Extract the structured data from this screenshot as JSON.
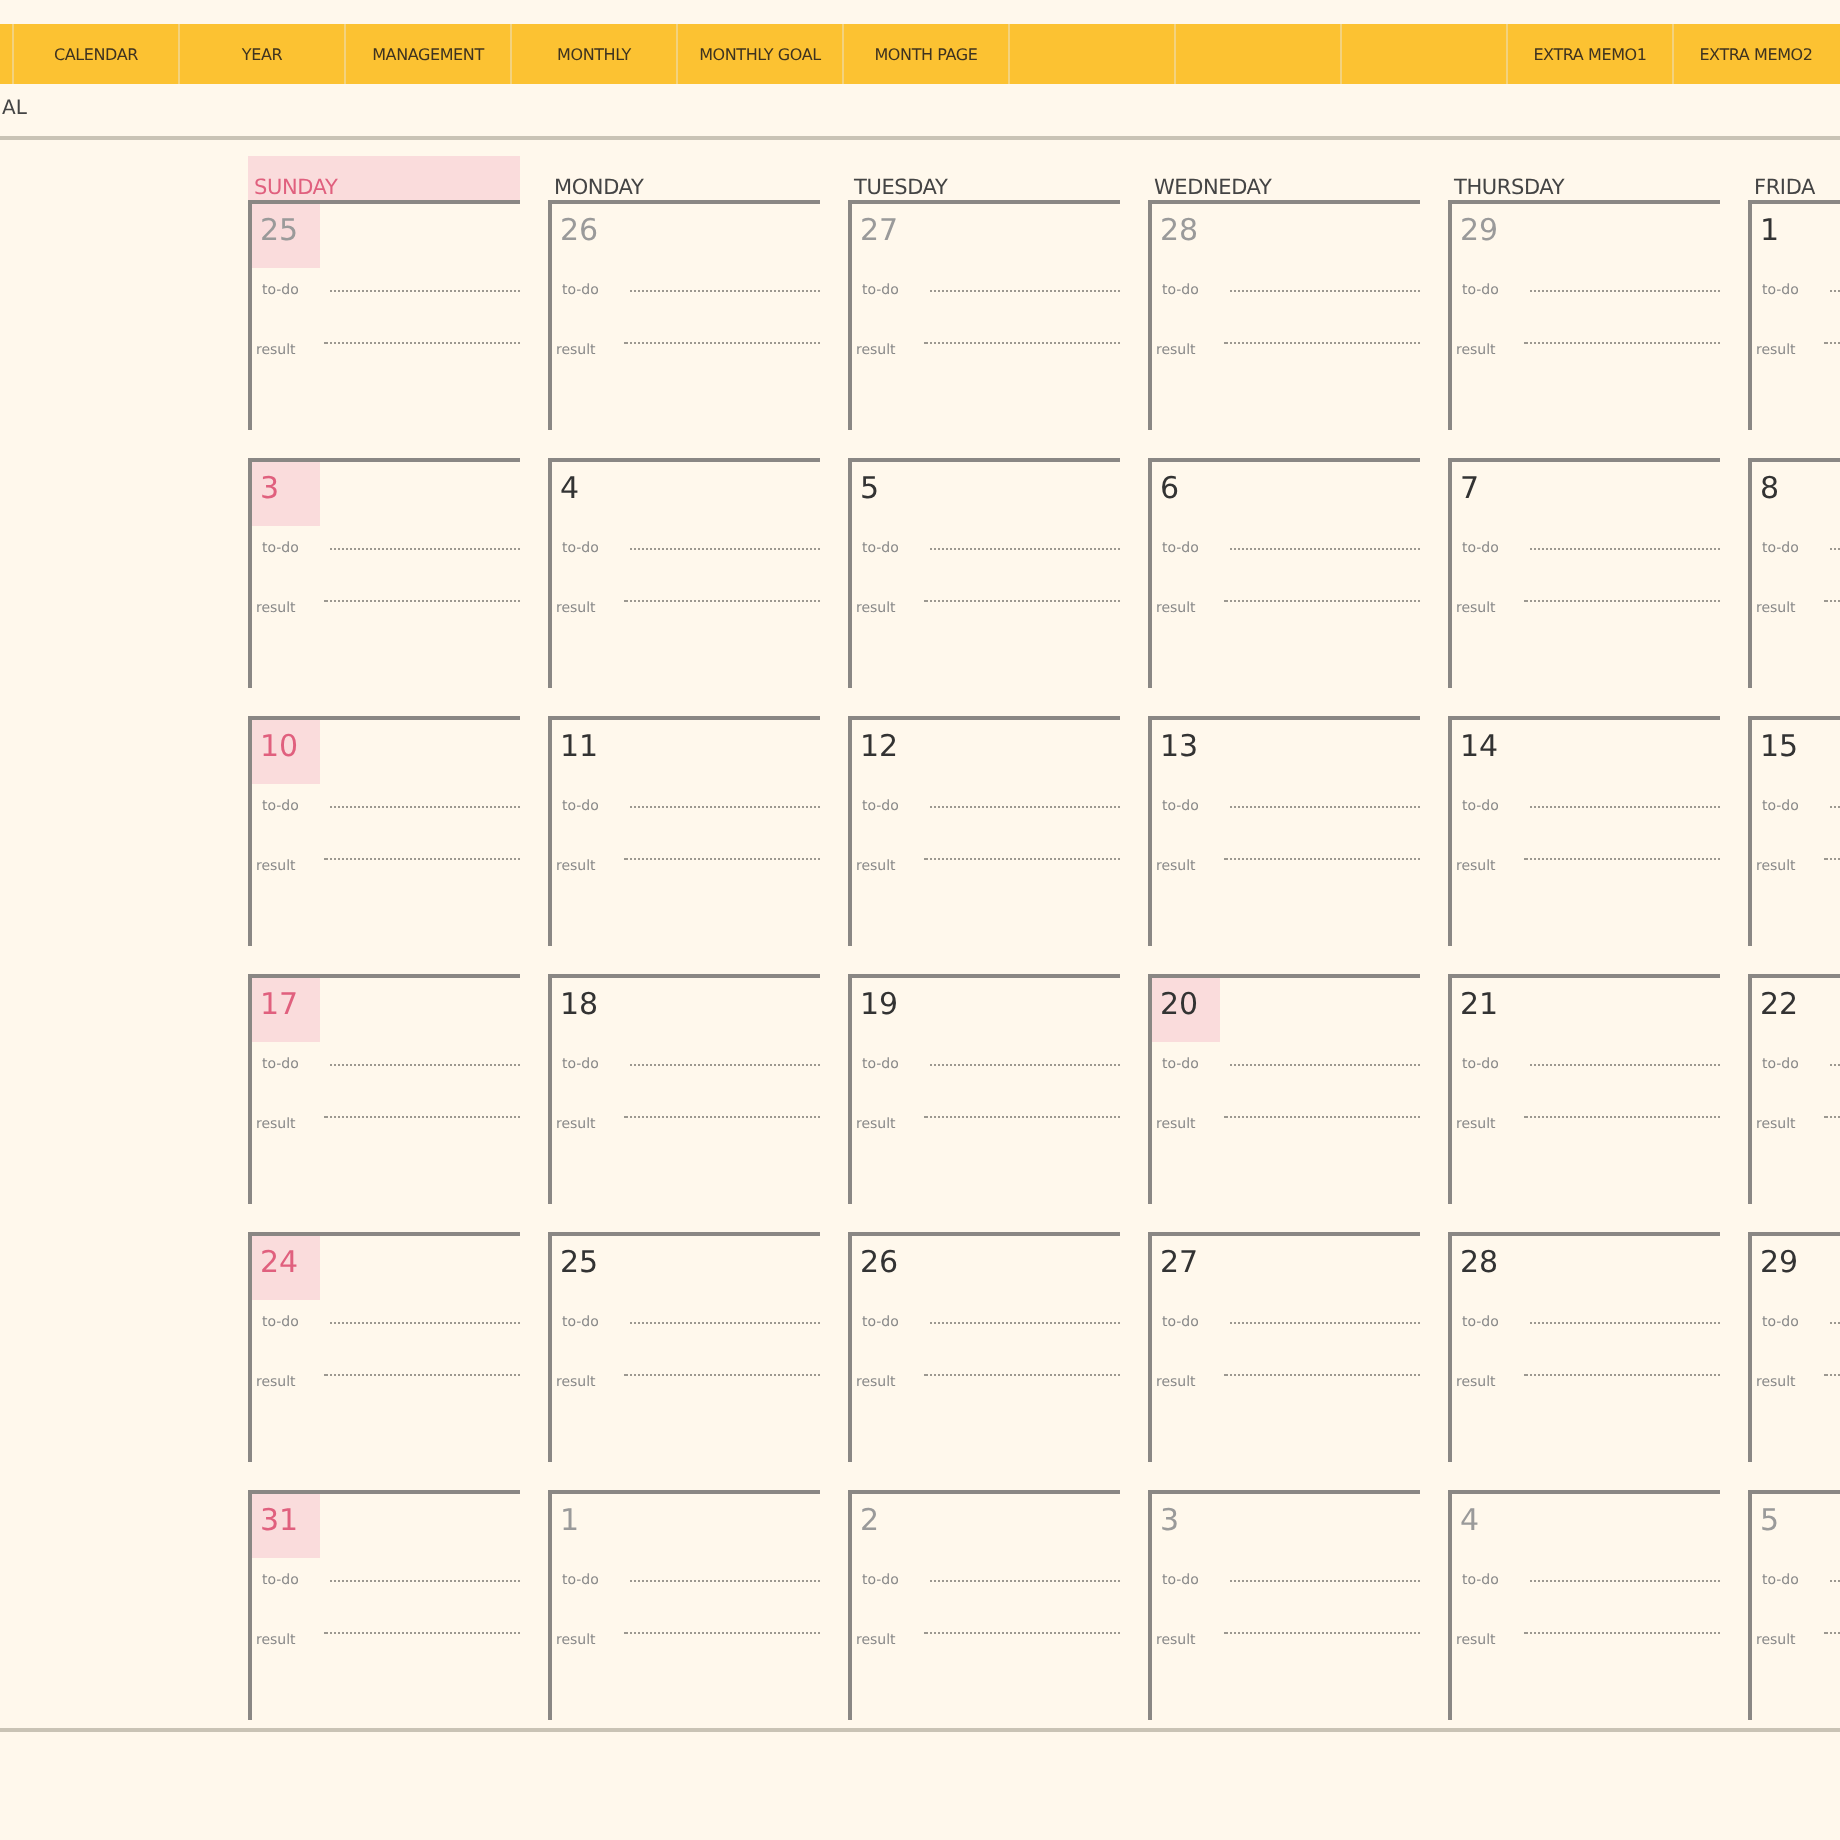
{
  "nav": {
    "tabs": [
      {
        "kind": "tab",
        "label": "CALENDAR"
      },
      {
        "kind": "tab",
        "label": "YEAR"
      },
      {
        "kind": "tab",
        "label": "MANAGEMENT"
      },
      {
        "kind": "tab",
        "label": "MONTHLY"
      },
      {
        "kind": "tab",
        "label": "MONTHLY GOAL"
      },
      {
        "kind": "tab",
        "label": "MONTH PAGE"
      },
      {
        "kind": "blank"
      },
      {
        "kind": "blank"
      },
      {
        "kind": "blank"
      },
      {
        "kind": "tab",
        "label": "EXTRA MEMO1"
      },
      {
        "kind": "tab",
        "label": "EXTRA MEMO2"
      }
    ]
  },
  "subtitle": "AL",
  "calendar": {
    "days_of_week": [
      {
        "label": "SUNDAY",
        "highlighted": true
      },
      {
        "label": "MONDAY",
        "highlighted": false
      },
      {
        "label": "TUESDAY",
        "highlighted": false
      },
      {
        "label": "WEDNEDAY",
        "highlighted": false
      },
      {
        "label": "THURSDAY",
        "highlighted": false
      },
      {
        "label": "FRIDA",
        "highlighted": false
      }
    ],
    "weeks": [
      [
        {
          "date": "25",
          "kind": "muted-holiday",
          "todo": "to-do",
          "result": "result"
        },
        {
          "date": "26",
          "kind": "muted",
          "todo": "to-do",
          "result": "result"
        },
        {
          "date": "27",
          "kind": "muted",
          "todo": "to-do",
          "result": "result"
        },
        {
          "date": "28",
          "kind": "muted",
          "todo": "to-do",
          "result": "result"
        },
        {
          "date": "29",
          "kind": "muted",
          "todo": "to-do",
          "result": "result"
        },
        {
          "date": "1",
          "kind": "normal",
          "todo": "to-do",
          "result": "result"
        }
      ],
      [
        {
          "date": "3",
          "kind": "holiday",
          "todo": "to-do",
          "result": "result"
        },
        {
          "date": "4",
          "kind": "normal",
          "todo": "to-do",
          "result": "result"
        },
        {
          "date": "5",
          "kind": "normal",
          "todo": "to-do",
          "result": "result"
        },
        {
          "date": "6",
          "kind": "normal",
          "todo": "to-do",
          "result": "result"
        },
        {
          "date": "7",
          "kind": "normal",
          "todo": "to-do",
          "result": "result"
        },
        {
          "date": "8",
          "kind": "normal",
          "todo": "to-do",
          "result": "result"
        }
      ],
      [
        {
          "date": "10",
          "kind": "holiday",
          "todo": "to-do",
          "result": "result"
        },
        {
          "date": "11",
          "kind": "normal",
          "todo": "to-do",
          "result": "result"
        },
        {
          "date": "12",
          "kind": "normal",
          "todo": "to-do",
          "result": "result"
        },
        {
          "date": "13",
          "kind": "normal",
          "todo": "to-do",
          "result": "result"
        },
        {
          "date": "14",
          "kind": "normal",
          "todo": "to-do",
          "result": "result"
        },
        {
          "date": "15",
          "kind": "normal",
          "todo": "to-do",
          "result": "result"
        }
      ],
      [
        {
          "date": "17",
          "kind": "holiday",
          "todo": "to-do",
          "result": "result"
        },
        {
          "date": "18",
          "kind": "normal",
          "todo": "to-do",
          "result": "result"
        },
        {
          "date": "19",
          "kind": "normal",
          "todo": "to-do",
          "result": "result"
        },
        {
          "date": "20",
          "kind": "marked",
          "todo": "to-do",
          "result": "result"
        },
        {
          "date": "21",
          "kind": "normal",
          "todo": "to-do",
          "result": "result"
        },
        {
          "date": "22",
          "kind": "normal",
          "todo": "to-do",
          "result": "result"
        }
      ],
      [
        {
          "date": "24",
          "kind": "holiday",
          "todo": "to-do",
          "result": "result"
        },
        {
          "date": "25",
          "kind": "normal",
          "todo": "to-do",
          "result": "result"
        },
        {
          "date": "26",
          "kind": "normal",
          "todo": "to-do",
          "result": "result"
        },
        {
          "date": "27",
          "kind": "normal",
          "todo": "to-do",
          "result": "result"
        },
        {
          "date": "28",
          "kind": "normal",
          "todo": "to-do",
          "result": "result"
        },
        {
          "date": "29",
          "kind": "normal",
          "todo": "to-do",
          "result": "result"
        }
      ],
      [
        {
          "date": "31",
          "kind": "holiday",
          "todo": "to-do",
          "result": "result"
        },
        {
          "date": "1",
          "kind": "muted",
          "todo": "to-do",
          "result": "result"
        },
        {
          "date": "2",
          "kind": "muted",
          "todo": "to-do",
          "result": "result"
        },
        {
          "date": "3",
          "kind": "muted",
          "todo": "to-do",
          "result": "result"
        },
        {
          "date": "4",
          "kind": "muted",
          "todo": "to-do",
          "result": "result"
        },
        {
          "date": "5",
          "kind": "muted",
          "todo": "to-do",
          "result": "result"
        }
      ]
    ]
  }
}
